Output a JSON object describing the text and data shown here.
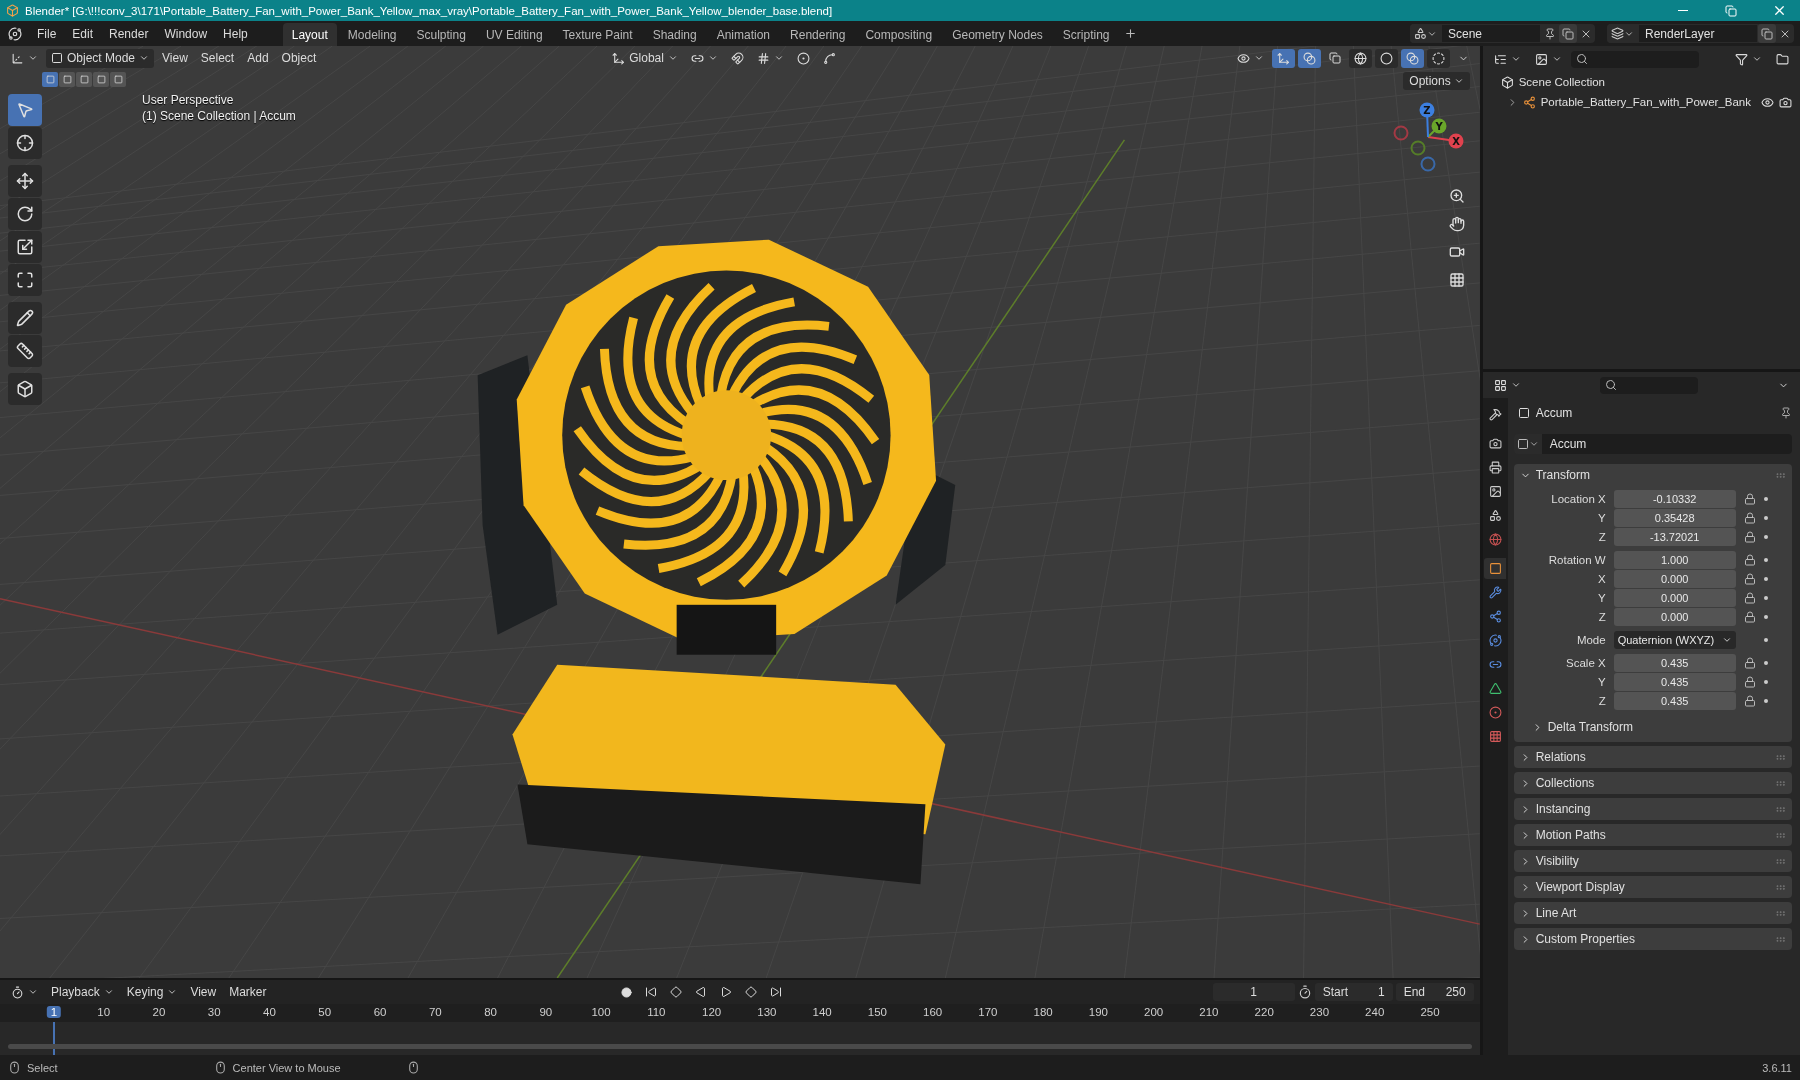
{
  "window": {
    "title": "Blender* [G:\\!!!conv_3\\171\\Portable_Battery_Fan_with_Power_Bank_Yellow_max_vray\\Portable_Battery_Fan_with_Power_Bank_Yellow_blender_base.blend]"
  },
  "menu": [
    "File",
    "Edit",
    "Render",
    "Window",
    "Help"
  ],
  "workspaces": [
    {
      "label": "Layout",
      "selected": true
    },
    {
      "label": "Modeling",
      "selected": false
    },
    {
      "label": "Sculpting",
      "selected": false
    },
    {
      "label": "UV Editing",
      "selected": false
    },
    {
      "label": "Texture Paint",
      "selected": false
    },
    {
      "label": "Shading",
      "selected": false
    },
    {
      "label": "Animation",
      "selected": false
    },
    {
      "label": "Rendering",
      "selected": false
    },
    {
      "label": "Compositing",
      "selected": false
    },
    {
      "label": "Geometry Nodes",
      "selected": false
    },
    {
      "label": "Scripting",
      "selected": false
    }
  ],
  "scene": "Scene",
  "view_layer": "RenderLayer",
  "viewport": {
    "mode": "Object Mode",
    "menus": [
      "View",
      "Select",
      "Add",
      "Object"
    ],
    "orientation": "Global",
    "options": "Options",
    "select_modes": [
      {
        "selected": true
      },
      {
        "selected": false
      },
      {
        "selected": false
      },
      {
        "selected": false
      },
      {
        "selected": false
      }
    ],
    "shading": [
      {
        "selected": false
      },
      {
        "selected": false
      },
      {
        "selected": true
      },
      {
        "selected": false
      }
    ],
    "info": [
      "User Perspective",
      "(1) Scene Collection | Accum"
    ],
    "tools": [
      {
        "selected": true
      },
      {
        "selected": false
      },
      {
        "selected": false
      },
      {
        "selected": false
      },
      {
        "selected": false
      },
      {
        "selected": false
      },
      {
        "selected": false
      },
      {
        "selected": false
      },
      {
        "selected": false
      }
    ],
    "gizmo_axes": [
      "X",
      "Y",
      "Z"
    ]
  },
  "outliner": {
    "root": "Scene Collection",
    "children": [
      {
        "label": "Portable_Battery_Fan_with_Power_Bank",
        "expanded": false
      }
    ]
  },
  "properties": {
    "tabs": [
      {
        "selected": false
      },
      {
        "selected": false
      },
      {
        "selected": false
      },
      {
        "selected": false
      },
      {
        "selected": false
      },
      {
        "selected": false
      },
      {
        "selected": true
      },
      {
        "selected": false
      },
      {
        "selected": false
      },
      {
        "selected": false
      },
      {
        "selected": false
      },
      {
        "selected": false
      },
      {
        "selected": false
      },
      {
        "selected": false
      }
    ],
    "object": "Accum",
    "datablock": "Accum",
    "transform": {
      "label": "Transform",
      "expanded": true,
      "groups": [
        [
          {
            "kind": "number",
            "label": "Location X",
            "value": "-0.10332"
          },
          {
            "kind": "number",
            "label": "Y",
            "value": "0.35428"
          },
          {
            "kind": "number",
            "label": "Z",
            "value": "-13.72021"
          }
        ],
        [
          {
            "kind": "number",
            "label": "Rotation W",
            "value": "1.000"
          },
          {
            "kind": "number",
            "label": "X",
            "value": "0.000"
          },
          {
            "kind": "number",
            "label": "Y",
            "value": "0.000"
          },
          {
            "kind": "number",
            "label": "Z",
            "value": "0.000"
          }
        ],
        [
          {
            "kind": "dropdown",
            "label": "Mode",
            "value": "Quaternion (WXYZ)"
          }
        ],
        [
          {
            "kind": "number",
            "label": "Scale X",
            "value": "0.435"
          },
          {
            "kind": "number",
            "label": "Y",
            "value": "0.435"
          },
          {
            "kind": "number",
            "label": "Z",
            "value": "0.435"
          }
        ]
      ],
      "sub_panel": {
        "label": "Delta Transform",
        "expanded": false
      }
    },
    "panels": [
      {
        "label": "Relations",
        "expanded": false
      },
      {
        "label": "Collections",
        "expanded": false
      },
      {
        "label": "Instancing",
        "expanded": false
      },
      {
        "label": "Motion Paths",
        "expanded": false
      },
      {
        "label": "Visibility",
        "expanded": false
      },
      {
        "label": "Viewport Display",
        "expanded": false
      },
      {
        "label": "Line Art",
        "expanded": false
      },
      {
        "label": "Custom Properties",
        "expanded": false
      }
    ]
  },
  "timeline": {
    "menus": [
      "Playback",
      "Keying",
      "View",
      "Marker"
    ],
    "current_frame": "1",
    "start": {
      "label": "Start",
      "value": "1"
    },
    "end": {
      "label": "End",
      "value": "250"
    },
    "ruler": [
      {
        "label": "1",
        "selected": true
      },
      {
        "label": "10",
        "selected": false
      },
      {
        "label": "20",
        "selected": false
      },
      {
        "label": "30",
        "selected": false
      },
      {
        "label": "40",
        "selected": false
      },
      {
        "label": "50",
        "selected": false
      },
      {
        "label": "60",
        "selected": false
      },
      {
        "label": "70",
        "selected": false
      },
      {
        "label": "80",
        "selected": false
      },
      {
        "label": "90",
        "selected": false
      },
      {
        "label": "100",
        "selected": false
      },
      {
        "label": "110",
        "selected": false
      },
      {
        "label": "120",
        "selected": false
      },
      {
        "label": "130",
        "selected": false
      },
      {
        "label": "140",
        "selected": false
      },
      {
        "label": "150",
        "selected": false
      },
      {
        "label": "160",
        "selected": false
      },
      {
        "label": "170",
        "selected": false
      },
      {
        "label": "180",
        "selected": false
      },
      {
        "label": "190",
        "selected": false
      },
      {
        "label": "200",
        "selected": false
      },
      {
        "label": "210",
        "selected": false
      },
      {
        "label": "220",
        "selected": false
      },
      {
        "label": "230",
        "selected": false
      },
      {
        "label": "240",
        "selected": false
      },
      {
        "label": "250",
        "selected": false
      }
    ]
  },
  "status_bar": {
    "hints": [
      "Select",
      "Center View to Mouse"
    ],
    "version": "3.6.11"
  }
}
